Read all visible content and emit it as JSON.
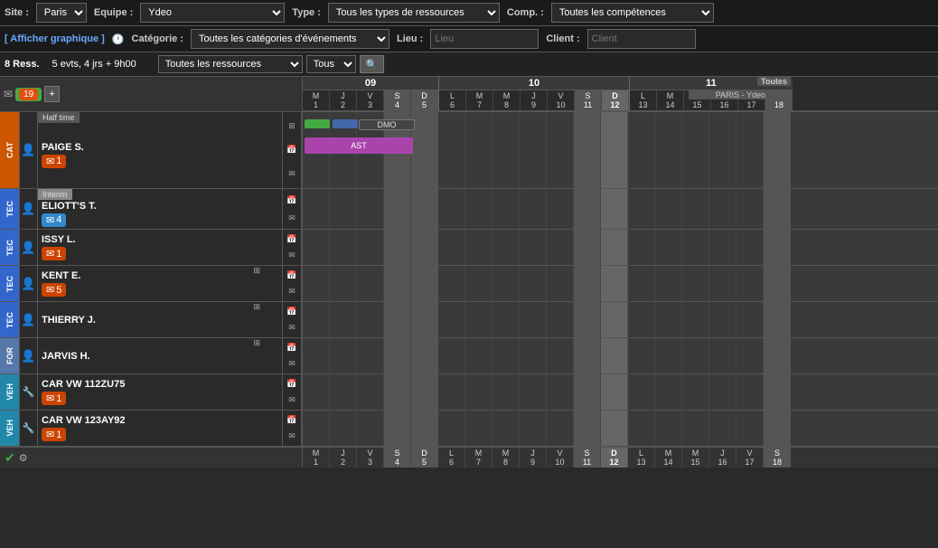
{
  "topBar": {
    "siteLabel": "Site :",
    "siteValue": "Paris",
    "equipeLabel": "Equipe :",
    "equipeValue": "Ydeo",
    "typeLabel": "Type :",
    "typeValue": "Tous les types de ressources",
    "compLabel": "Comp. :",
    "compValue": "Toutes les compétences",
    "categorieLabel": "Catégorie :",
    "categorieValue": "Toutes les catégories d'événements",
    "lieuLabel": "Lieu :",
    "lieuPlaceholder": "Lieu",
    "clientLabel": "Client :",
    "clientPlaceholder": "Client"
  },
  "secondBar": {
    "afficherText": "[ Afficher graphique ]"
  },
  "filterBar": {
    "resourcesValue": "Toutes les ressources",
    "tousValue": "Tous",
    "searchPlaceholder": "Rechercher"
  },
  "infoBar": {
    "ressText": "8 Ress.",
    "evtsText": "5 evts, 4 jrs + 9h00"
  },
  "calendar": {
    "weeks": [
      {
        "num": "09",
        "days": [
          "M\n1",
          "J\n2",
          "V\n3",
          "S\n4",
          "D\n5"
        ]
      },
      {
        "num": "10",
        "days": [
          "L\n6",
          "M\n7",
          "M\n8",
          "J\n9",
          "V\n10",
          "S\n11",
          "D\n12"
        ]
      },
      {
        "num": "11",
        "days": [
          "L\n13",
          "M\n14",
          "M\n15",
          "J\n16",
          "V\n17",
          "S\n18"
        ]
      }
    ]
  },
  "resources": [
    {
      "type": "CAT",
      "typeClass": "type-cat",
      "icon": "👤",
      "name": "PAIGE S.",
      "tag": "Half time",
      "tagClass": "",
      "badge": "1",
      "badgeClass": ""
    },
    {
      "type": "TEC",
      "typeClass": "type-tec",
      "icon": "👤",
      "name": "ELIOTT'S T.",
      "tag": "Interim",
      "tagClass": "interim",
      "badge": "4",
      "badgeClass": "blue"
    },
    {
      "type": "TEC",
      "typeClass": "type-tec",
      "icon": "👤",
      "name": "ISSY L.",
      "tag": "",
      "tagClass": "",
      "badge": "1",
      "badgeClass": ""
    },
    {
      "type": "TEC",
      "typeClass": "type-tec",
      "icon": "👤",
      "name": "KENT E.",
      "tag": "",
      "tagClass": "",
      "badge": "5",
      "badgeClass": ""
    },
    {
      "type": "TEC",
      "typeClass": "type-tec",
      "icon": "👤",
      "name": "THIERRY J.",
      "tag": "",
      "tagClass": "",
      "badge": "",
      "badgeClass": ""
    },
    {
      "type": "FOR",
      "typeClass": "type-for",
      "icon": "👤",
      "name": "JARVIS H.",
      "tag": "",
      "tagClass": "",
      "badge": "",
      "badgeClass": ""
    },
    {
      "type": "VEH",
      "typeClass": "type-veh",
      "icon": "🔧",
      "name": "CAR VW 112ZU75",
      "tag": "",
      "tagClass": "",
      "badge": "1",
      "badgeClass": ""
    },
    {
      "type": "VEH",
      "typeClass": "type-veh",
      "icon": "🔧",
      "name": "CAR VW 123AY92",
      "tag": "",
      "tagClass": "",
      "badge": "1",
      "badgeClass": ""
    }
  ],
  "notificationBadge": "19",
  "parisYdeo": "PARIS - Ydeo",
  "toutes": "Toutes"
}
